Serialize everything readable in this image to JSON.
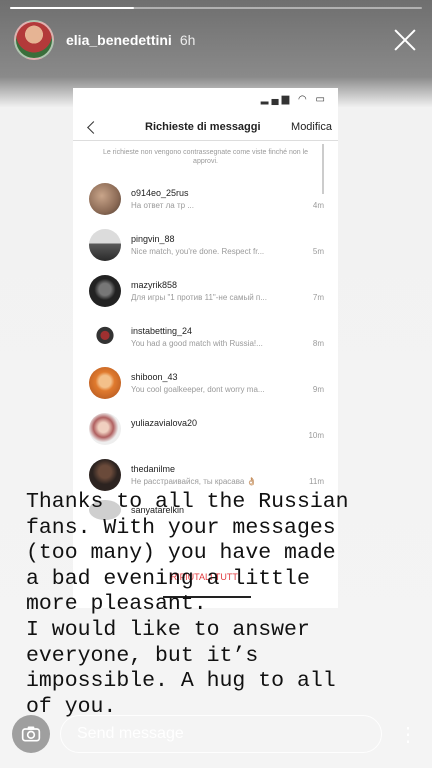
{
  "story": {
    "username": "elia_benedettini",
    "time": "6h",
    "progress": 0.3
  },
  "screenshot": {
    "title": "Richieste di messaggi",
    "edit_label": "Modifica",
    "notice": "Le richieste non vengono contrassegnate come viste finché non le approvi.",
    "messages": [
      {
        "user": "o914eo_25rus",
        "text": "На ответ ла тр ...",
        "time": "4m",
        "color": "#8b6a55"
      },
      {
        "user": "pingvin_88",
        "text": "Nice match, you're done. Respect fr...",
        "time": "5m",
        "color": "#3c3c3c"
      },
      {
        "user": "mazyrik858",
        "text": "Для игры \"1 против 11\"-не самый п...",
        "time": "7m",
        "color": "#2a2a2a"
      },
      {
        "user": "instabetting_24",
        "text": "You had a good match with Russia!...",
        "time": "8m",
        "color": "#ffffff"
      },
      {
        "user": "shiboon_43",
        "text": "You cool goalkeeper, dont worry ma...",
        "time": "9m",
        "color": "#e07a2e"
      },
      {
        "user": "yuliazavialova20",
        "text": "",
        "time": "10m",
        "color": "#b06060"
      },
      {
        "user": "thedanilme",
        "text": "Не расстраивайся, ты красава 👌🏼",
        "time": "11m",
        "color": "#2c2320"
      }
    ],
    "partial_user": "sanyatarelkin",
    "reject_all": "RIFIUTALI TUTTI"
  },
  "caption": "Thanks to all the Russian\nfans. With your messages\n(too many) you have made\na bad evening a little\nmore pleasant.\nI would like to answer\neveryone, but it’s\nimpossible. A hug to all\nof you.",
  "reply": {
    "placeholder": "Send message"
  }
}
